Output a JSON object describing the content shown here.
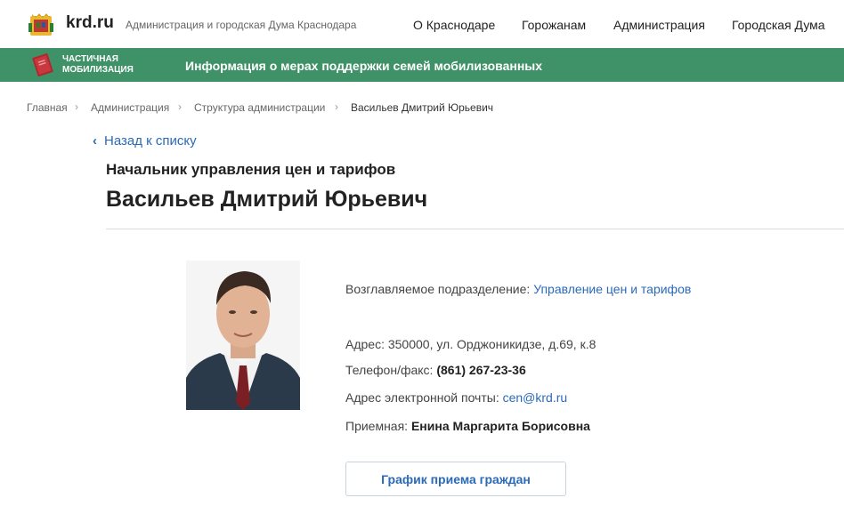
{
  "header": {
    "site_name": "krd.ru",
    "site_subtitle": "Администрация и городская Дума Краснодара",
    "nav": [
      "О Краснодаре",
      "Горожанам",
      "Администрация",
      "Городская Дума"
    ],
    "logo_icon": "city-coat-of-arms-icon"
  },
  "banner": {
    "label_line1": "Частичная",
    "label_line2": "мобилизация",
    "text": "Информация о мерах поддержки семей мобилизованных",
    "icon": "red-book-icon",
    "color": "#3f9167"
  },
  "breadcrumb": [
    "Главная",
    "Администрация",
    "Структура администрации",
    "Васильев Дмитрий Юрьевич"
  ],
  "back_label": "Назад к списку",
  "person": {
    "position": "Начальник управления цен и тарифов",
    "name": "Васильев Дмитрий Юрьевич"
  },
  "info": {
    "department_label": "Возглавляемое подразделение:",
    "department_value": "Управление цен и тарифов",
    "address_label": "Адрес:",
    "address_value": "350000, ул. Орджоникидзе, д.69, к.8",
    "phone_label": "Телефон/факс:",
    "phone_value": "(861) 267-23-36",
    "email_label": "Адрес электронной почты:",
    "email_value": "cen@krd.ru",
    "reception_label": "Приемная:",
    "reception_value": "Енина Маргарита Борисовна"
  },
  "schedule_button": "График приема граждан",
  "colors": {
    "link": "#2a6ab8",
    "accent_green": "#3f9167"
  }
}
